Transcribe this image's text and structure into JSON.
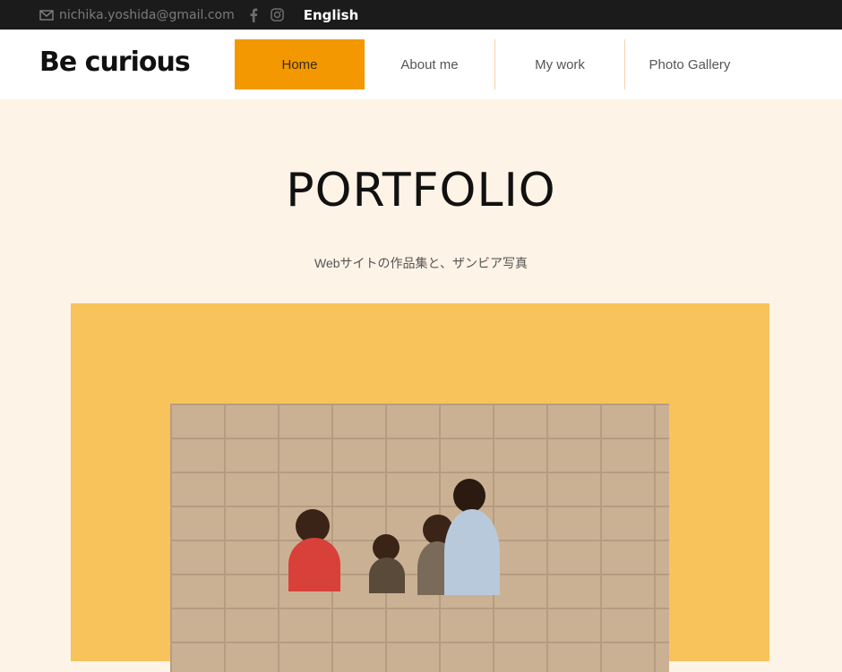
{
  "topbar": {
    "email": "nichika.yoshida@gmail.com",
    "language": "English"
  },
  "header": {
    "brand": "Be curious",
    "nav": [
      {
        "label": "Home",
        "active": true
      },
      {
        "label": "About me",
        "active": false
      },
      {
        "label": "My work",
        "active": false
      },
      {
        "label": "Photo Gallery",
        "active": false
      }
    ]
  },
  "hero": {
    "title": "PORTFOLIO",
    "subtitle": "Webサイトの作品集と、ザンビア写真"
  },
  "colors": {
    "accent": "#f39800",
    "panel": "#f8c35a",
    "background": "#fdf3e6"
  }
}
